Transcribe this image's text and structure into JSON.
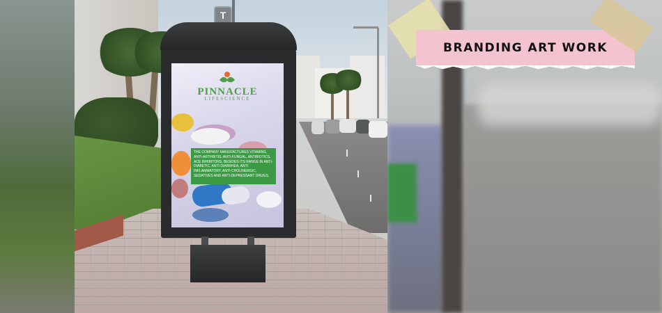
{
  "banner": {
    "title": "BRANDING ART WORK"
  },
  "poster": {
    "brand_name": "PINNACLE",
    "brand_tagline": "LIFESCIENCE",
    "description": "THE COMPANY MANUFACTURES VITAMINS, ANTI-ARTHRITIS, ANTI-FUNGAL, ANTIBIOTICS, ACE INHIBITORS, BESIDES ITS RANGE IN ANTI-DIABETIC, ANTI DIARRHEA, ANTI INFLAMMATORY, ANTI-CHOLINERGIC, SEDATIVES AND ANTI-DEPRESSANT DRUGS."
  },
  "scene": {
    "bus_stop_sign": "T"
  },
  "colors": {
    "brand_green": "#4f9e46",
    "label_pink": "#f3c3cf",
    "text_dark": "#121212"
  }
}
